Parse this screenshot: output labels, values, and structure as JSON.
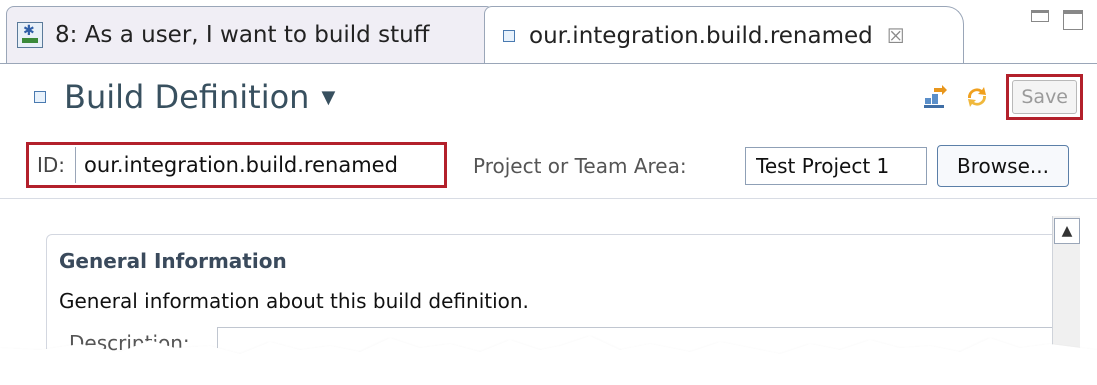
{
  "tabs": {
    "inactive_label": "8: As a user, I want to build stuff",
    "active_label": "our.integration.build.renamed",
    "close_glyph": "☒"
  },
  "header": {
    "title": "Build Definition",
    "save_label": "Save"
  },
  "id_row": {
    "id_label": "ID:",
    "id_value": "our.integration.build.renamed",
    "project_label": "Project or Team Area:",
    "project_value": "Test Project 1",
    "browse_label": "Browse..."
  },
  "section": {
    "title": "General Information",
    "description": "General information about this build definition.",
    "description_label": "Description:"
  },
  "colors": {
    "highlight_red": "#b3202b",
    "title_color": "#38505f"
  }
}
